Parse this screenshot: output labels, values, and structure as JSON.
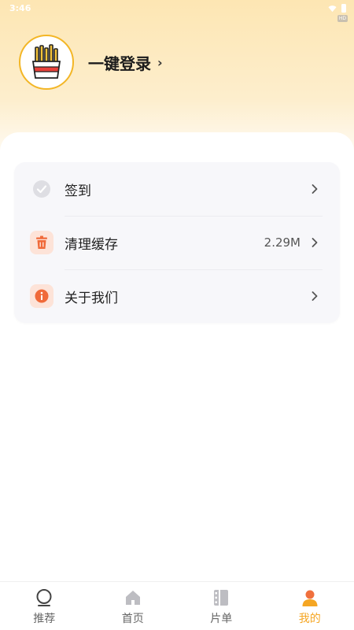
{
  "status_bar": {
    "time": "3:46",
    "badge": "HD"
  },
  "profile": {
    "login_label": "一键登录"
  },
  "menu": {
    "items": [
      {
        "label": "签到",
        "value": "",
        "icon": "check-circle-icon",
        "icon_color": "#d9d9de"
      },
      {
        "label": "清理缓存",
        "value": "2.29M",
        "icon": "trash-icon",
        "icon_color": "#f06a3a"
      },
      {
        "label": "关于我们",
        "value": "",
        "icon": "info-icon",
        "icon_color": "#f06a3a"
      }
    ]
  },
  "tabbar": {
    "tabs": [
      {
        "label": "推荐",
        "icon": "circle-icon",
        "active": false
      },
      {
        "label": "首页",
        "icon": "home-icon",
        "active": false
      },
      {
        "label": "片单",
        "icon": "film-list-icon",
        "active": false
      },
      {
        "label": "我的",
        "icon": "user-icon",
        "active": true
      }
    ]
  },
  "colors": {
    "accent": "#f5a623",
    "header_bg": "#fde6b3",
    "icon_orange": "#f06a3a"
  }
}
